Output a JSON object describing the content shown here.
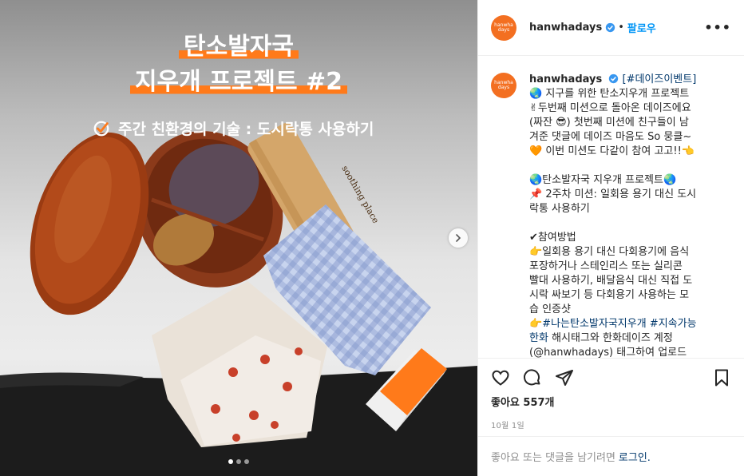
{
  "post": {
    "title_line1": "탄소발자국",
    "title_line2": "지우개 프로젝트 #2",
    "subtitle": "주간 친환경의 기술 : 도시락통 사용하기",
    "bamboo_text": "soothing place"
  },
  "header": {
    "avatar_text_top": "hanwha",
    "avatar_text_bottom": "days",
    "username": "hanwhadays",
    "separator": "•",
    "follow_label": "팔로우",
    "more_label": "•••"
  },
  "caption": {
    "username": "hanwhadays",
    "tag_line_first": "[#데이즈이벤트]",
    "lines": [
      "🌏 지구를 위한 탄소지우개 프로젝트",
      "✌두번째 미션으로 돌아온 데이즈에요",
      "(짜잔 😎) 첫번째 미션에 친구들이 남",
      "겨준 댓글에 데이즈 마음도 So 뭉클~",
      "🧡 이번 미션도 다같이 참여 고고!!👈",
      "🌏탄소발자국 지우개 프로젝트🌏",
      "📌 2주차 미션: 일회용 용기 대신 도시",
      "락통 사용하기",
      "✔참여방법",
      "👉일회용 용기 대신 다회용기에 음식",
      "포장하거나 스테인리스 또는 실리콘",
      "빨대 사용하기, 배달음식 대신 직접 도",
      "시락 싸보기 등 다회용기 사용하는 모",
      "습 인증샷",
      "해시태그와 한화데이즈 계정",
      "(@hanwhadays) 태그하여 업로드"
    ],
    "hashtag_line_a": "👉#나는탄소발자국지우개 #지속가능",
    "hashtag_line_b": "한화"
  },
  "actions": {
    "likes": "좋아요 557개",
    "date": "10월 1일"
  },
  "comment": {
    "prompt": "좋아요 또는 댓글을 남기려면",
    "login": "로그인."
  },
  "icons": [
    "check-circle-icon",
    "chevron-right-icon",
    "verified-icon",
    "heart-icon",
    "comment-icon",
    "share-icon",
    "bookmark-icon"
  ],
  "colors": {
    "accent_orange": "#ff7a1a",
    "brand_orange": "#f36f21",
    "link_blue": "#0095f6",
    "hashtag_blue": "#00376b"
  },
  "carousel": {
    "slide_count": 3,
    "active_slide": 1
  }
}
